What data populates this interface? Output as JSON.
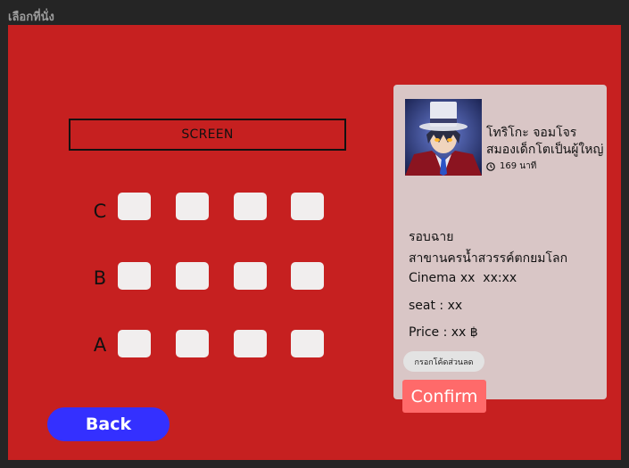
{
  "frame_label": "เลือกที่นั่ง",
  "screen_label": "SCREEN",
  "rows": [
    {
      "label": "C",
      "seats": 4
    },
    {
      "label": "B",
      "seats": 4
    },
    {
      "label": "A",
      "seats": 4
    }
  ],
  "back_label": "Back",
  "movie": {
    "title_line1": "โทริโกะ จอมโจร",
    "title_line2": "สมองเด็กโตเป็นผู้ใหญ่",
    "duration": "169 นาที"
  },
  "booking": {
    "showtime_label": "รอบฉาย",
    "branch": "สาขานครน้ำสวรรค์ตกยมโลก",
    "cinema": "Cinema xx  xx:xx",
    "seat": "seat : xx",
    "price": "Price : xx ฿"
  },
  "promo_label": "กรอกโค้ดส่วนลด",
  "confirm_label": "Confirm",
  "colors": {
    "background": "#c62020",
    "panel": "#d9c6c6",
    "back_button": "#3430ff",
    "confirm_button": "#ff6a6a",
    "seat": "#f1eeee"
  }
}
